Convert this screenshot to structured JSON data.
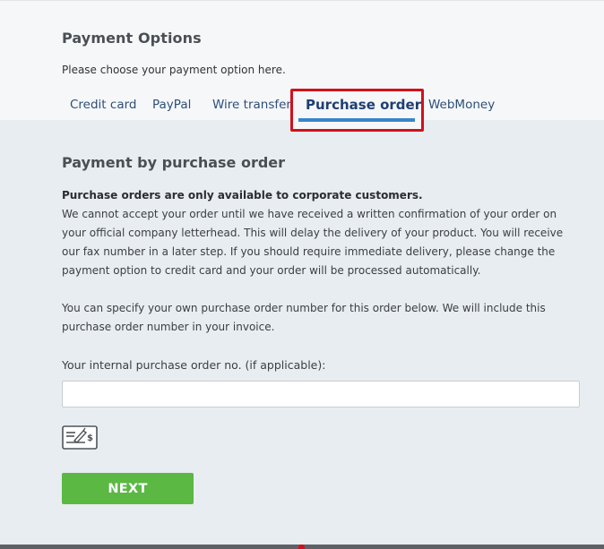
{
  "header": {
    "title": "Payment Options",
    "subtitle": "Please choose your payment option here."
  },
  "tabs": {
    "items": [
      {
        "label": "Credit card",
        "active": false
      },
      {
        "label": "PayPal",
        "active": false
      },
      {
        "label": "Wire transfer",
        "active": false
      },
      {
        "label": "Purchase order",
        "active": true
      },
      {
        "label": "WebMoney",
        "active": false
      }
    ]
  },
  "content": {
    "title": "Payment by purchase order",
    "notice": "Purchase orders are only available to corporate customers.",
    "paragraph1": "We cannot accept your order until we have received a written confirmation of your order on your official company letterhead. This will delay the delivery of your product. You will receive our fax number in a later step. If you should require immediate delivery, please change the payment option to credit card and your order will be processed automatically.",
    "paragraph2": "You can specify your own purchase order number for this order below. We will include this purchase order number in your invoice.",
    "field_label": "Your internal purchase order no. (if applicable):",
    "field_value": "",
    "field_placeholder": "",
    "icon": "check-payment-icon",
    "next_label": "NEXT"
  },
  "colors": {
    "accent_green": "#5ab843",
    "highlight_red": "#d1111b",
    "active_underline": "#3a86c8",
    "link_blue": "#2e4f78"
  }
}
